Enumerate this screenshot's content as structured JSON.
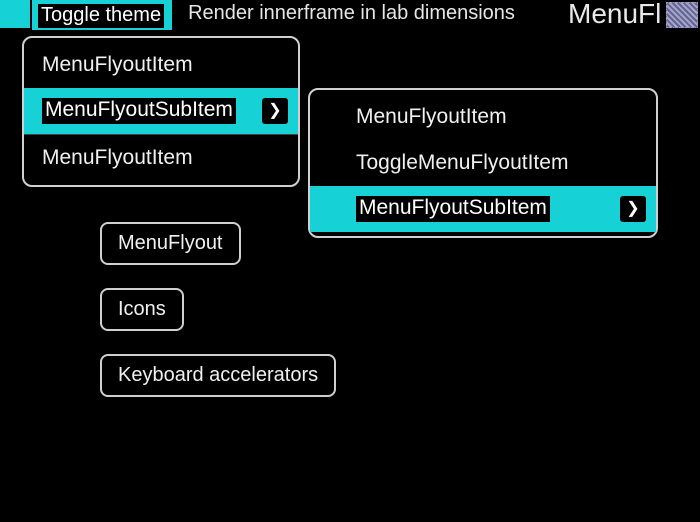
{
  "topbar": {
    "toggle_theme_label": "Toggle theme",
    "render_label": "Render innerframe in lab dimensions",
    "cropped_title": "MenuFl"
  },
  "menu1": {
    "items": [
      {
        "label": "MenuFlyoutItem",
        "active": false,
        "hasSubmenu": false
      },
      {
        "label": "MenuFlyoutSubItem",
        "active": true,
        "hasSubmenu": true
      },
      {
        "label": "MenuFlyoutItem",
        "active": false,
        "hasSubmenu": false
      }
    ]
  },
  "menu2": {
    "items": [
      {
        "label": "MenuFlyoutItem",
        "active": false,
        "hasSubmenu": false
      },
      {
        "label": "ToggleMenuFlyoutItem",
        "active": false,
        "hasSubmenu": false
      },
      {
        "label": "MenuFlyoutSubItem",
        "active": true,
        "hasSubmenu": true
      }
    ]
  },
  "buttons": {
    "menuflyout": "MenuFlyout",
    "icons": "Icons",
    "accelerators": "Keyboard accelerators"
  },
  "glyphs": {
    "chevron_right": "❯"
  },
  "colors": {
    "accent": "#16d1d6",
    "bg": "#000000",
    "fg": "#ffffff",
    "border": "#d0d0d0"
  }
}
